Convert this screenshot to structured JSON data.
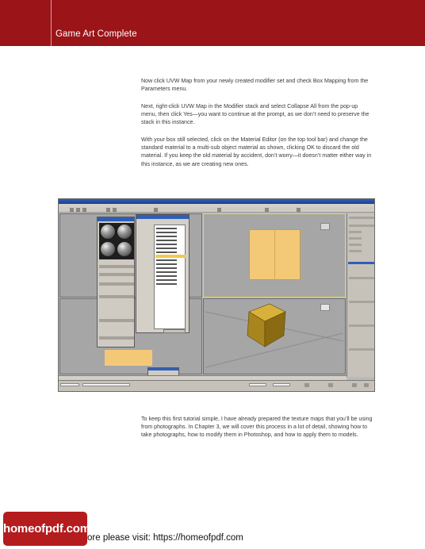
{
  "header": {
    "title": "Game Art Complete",
    "color": "#9a1418"
  },
  "body": {
    "paragraphs": [
      "Now click UVW Map from your newly created modifier set and check Box Mapping from the Parameters menu.",
      "Next, right-click UVW Map in the Modifier stack and select Collapse All from the pop-up menu, then click Yes—you want to continue at the prompt, as we don’t need to preserve the stack in this instance.",
      "With your box still selected, click on the Material Editor (on the top tool bar) and change the standard material to a multi-sub object material as shown, clicking OK to discard the old material. If you keep the old material by accident, don’t worry—it doesn’t matter either way in this instance, as we are creating new ones.",
      "To keep this first tutorial simple, I have already prepared the texture maps that you’ll be using from photographs. In Chapter 3, we will cover this process in a lot of detail, showing how to take photographs, how to modify them in Photoshop, and how to apply them to models."
    ]
  },
  "figure": {
    "material_color": "#f3c978",
    "cube_colors": [
      "#d8b13a",
      "#a8851f",
      "#8a6a12"
    ]
  },
  "footer": {
    "logo_text": "homeofpdf.com",
    "link_text": "ore please visit: https://homeofpdf.com",
    "logo_color": "#b51c1e"
  }
}
